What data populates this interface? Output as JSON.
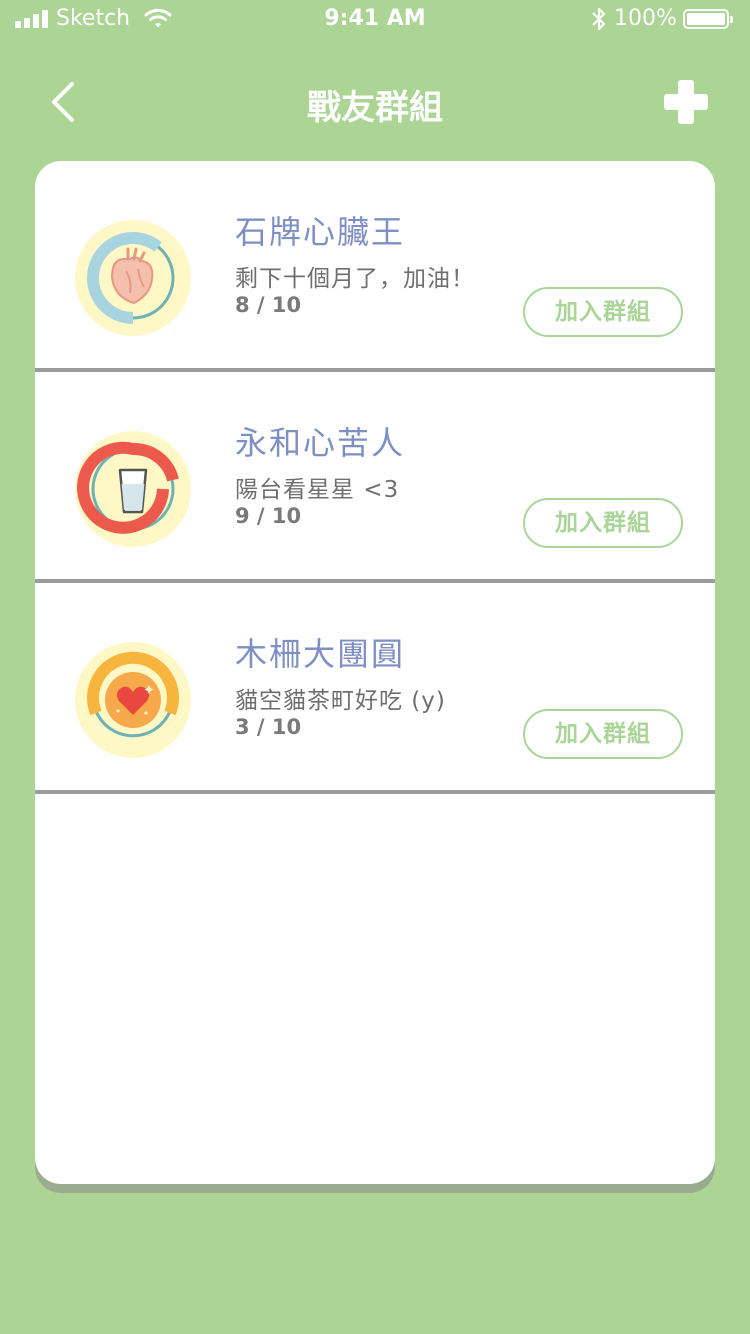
{
  "status_bar": {
    "carrier": "Sketch",
    "time": "9:41 AM",
    "battery": "100%"
  },
  "nav": {
    "title": "戰友群組",
    "back_icon": "chevron-left-icon",
    "add_icon": "plus-icon"
  },
  "colors": {
    "background": "#acd595",
    "card": "#ffffff",
    "accent_green": "#a9d598",
    "title_blue": "#7e8fc4",
    "divider": "#9b9b9b"
  },
  "groups": [
    {
      "name": "石牌心臟王",
      "description": "剩下十個月了，加油！",
      "count": "8 / 10",
      "join_label": "加入群組",
      "icon": "heart-organ-icon",
      "progress": 0.8
    },
    {
      "name": "永和心苦人",
      "description": "陽台看星星 <3",
      "count": "9 / 10",
      "join_label": "加入群組",
      "icon": "water-glass-icon",
      "progress": 0.9
    },
    {
      "name": "木柵大團圓",
      "description": "貓空貓茶町好吃 (y)",
      "count": "3 / 10",
      "join_label": "加入群組",
      "icon": "heart-medal-icon",
      "progress": 0.3
    }
  ]
}
